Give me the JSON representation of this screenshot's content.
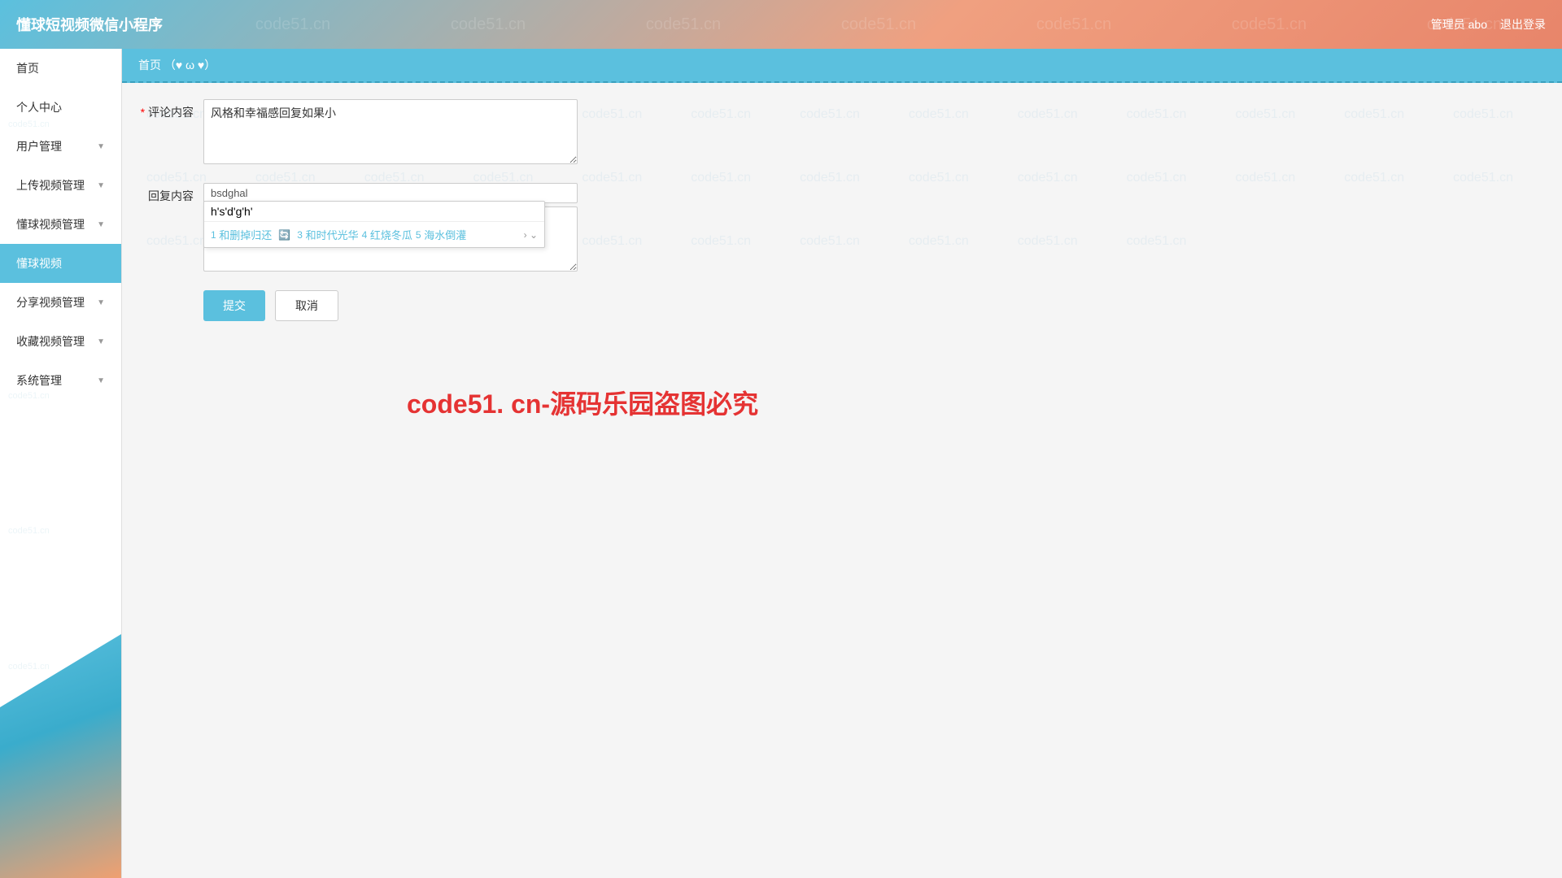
{
  "header": {
    "title": "懂球短视频微信小程序",
    "watermark_texts": [
      "code51.cn",
      "code51.cn",
      "code51.cn",
      "code51.cn",
      "code51.cn",
      "code51.cn"
    ],
    "admin_label": "管理员 abo",
    "logout_label": "退出登录"
  },
  "sidebar": {
    "items": [
      {
        "id": "home",
        "label": "首页",
        "has_arrow": false,
        "active": false
      },
      {
        "id": "personal",
        "label": "个人中心",
        "has_arrow": false,
        "active": false
      },
      {
        "id": "user-mgmt",
        "label": "用户管理",
        "has_arrow": true,
        "active": false
      },
      {
        "id": "upload-video",
        "label": "上传视频管理",
        "has_arrow": true,
        "active": false
      },
      {
        "id": "dongqiu-video-mgmt",
        "label": "懂球视频管理",
        "has_arrow": true,
        "active": false
      },
      {
        "id": "dongqiu-video",
        "label": "懂球视频",
        "has_arrow": false,
        "active": true
      },
      {
        "id": "share-video",
        "label": "分享视频管理",
        "has_arrow": true,
        "active": false
      },
      {
        "id": "collect-video",
        "label": "收藏视频管理",
        "has_arrow": true,
        "active": false
      },
      {
        "id": "sys-mgmt",
        "label": "系统管理",
        "has_arrow": true,
        "active": false
      }
    ]
  },
  "breadcrumb": {
    "home_label": "首页",
    "icons": "（♥ ω ♥）",
    "extra": ""
  },
  "form": {
    "comment_label": "* 评论内容",
    "comment_value": "风格和幸福感回复如果小",
    "reply_label": "回复内容",
    "reply_top_text": "bsdghal",
    "reply_main_text": "h's'd'g'h'",
    "autocomplete": {
      "input_placeholder": "",
      "suggestions": [
        {
          "num": "1",
          "text": "和删掉归还"
        },
        {
          "text": "icon",
          "is_icon": true
        },
        {
          "num": "3",
          "text": "和时代光华"
        },
        {
          "num": "4",
          "text": "红烧冬瓜"
        },
        {
          "num": "5",
          "text": "海水倒灌"
        }
      ]
    },
    "submit_label": "提交",
    "cancel_label": "取消"
  },
  "promo": {
    "text": "code51. cn-源码乐园盗图必究"
  },
  "watermark": {
    "text": "code51.cn"
  }
}
